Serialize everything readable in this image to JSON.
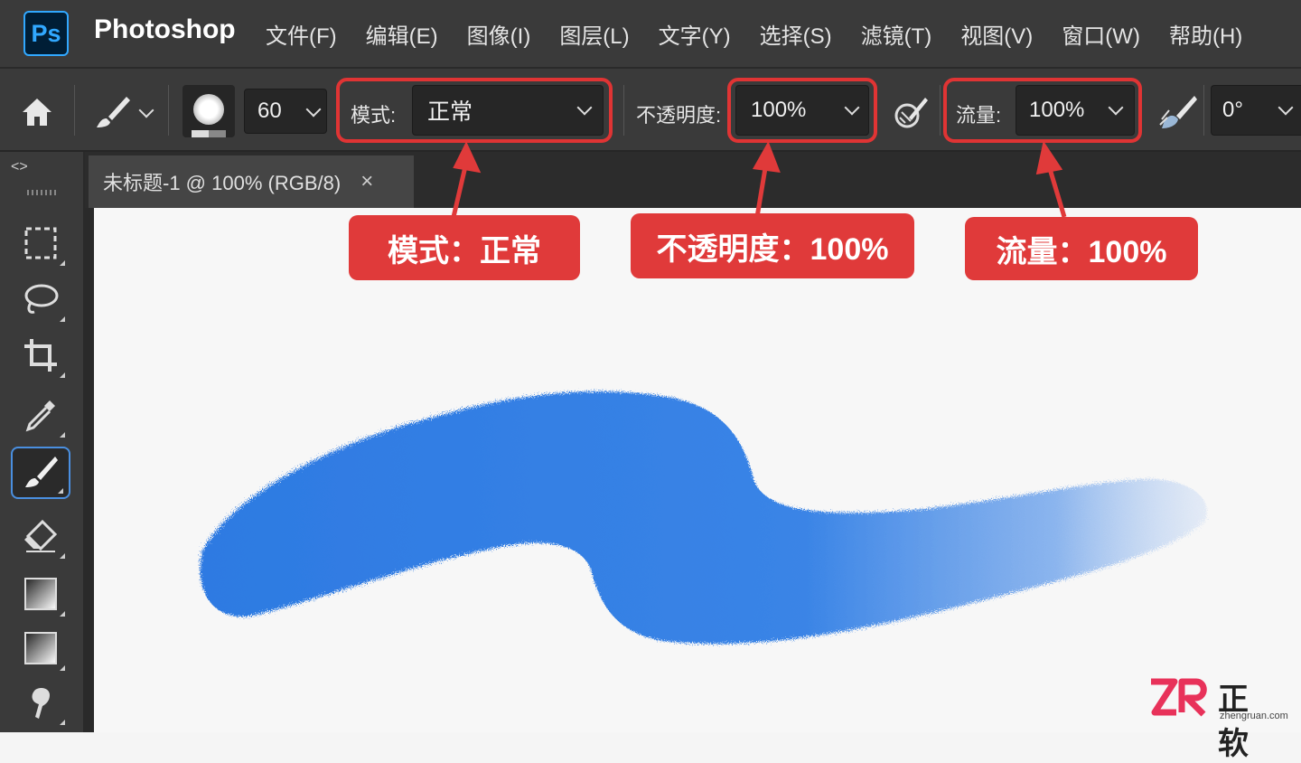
{
  "app": {
    "logo": "Ps",
    "name": "Photoshop"
  },
  "menu": [
    "文件(F)",
    "编辑(E)",
    "图像(I)",
    "图层(L)",
    "文字(Y)",
    "选择(S)",
    "滤镜(T)",
    "视图(V)",
    "窗口(W)",
    "帮助(H)"
  ],
  "options": {
    "brush_size": "60",
    "mode_label": "模式:",
    "mode_value": "正常",
    "opacity_label": "不透明度:",
    "opacity_value": "100%",
    "flow_label": "流量:",
    "flow_value": "100%",
    "angle_value": "0°"
  },
  "callouts": {
    "mode": "模式：正常",
    "opacity": "不透明度：100%",
    "flow": "流量：100%"
  },
  "toolbar": {
    "collapse": "<>"
  },
  "document_tab": {
    "title": "未标题-1 @ 100% (RGB/8)",
    "close": "×"
  },
  "watermark": {
    "brand": "正软",
    "url": "zhengruan.com"
  },
  "colors": {
    "accent": "#e03a3a",
    "brush_stroke": "#2f7de1",
    "ps_blue": "#31a8ff"
  },
  "icons": [
    "home-icon",
    "brush-icon",
    "airbrush-icon",
    "pressure-icon",
    "marquee-icon",
    "lasso-icon",
    "crop-icon",
    "eyedropper-icon",
    "eraser-icon",
    "gradient-icon",
    "smudge-icon"
  ]
}
